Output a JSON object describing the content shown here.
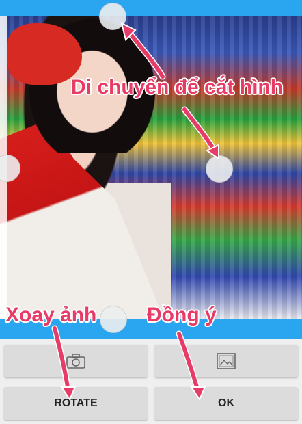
{
  "annotations": {
    "crop_hint": "Di chuyển để cắt hình",
    "rotate_hint": "Xoay ảnh",
    "ok_hint": "Đồng ý"
  },
  "buttons": {
    "camera_icon": "camera-icon",
    "gallery_icon": "image-icon",
    "rotate_label": "ROTATE",
    "ok_label": "OK"
  },
  "colors": {
    "accent_blue": "#29a6ef",
    "annotation_pink": "#e83c68",
    "button_gray": "#dcdcdc"
  }
}
